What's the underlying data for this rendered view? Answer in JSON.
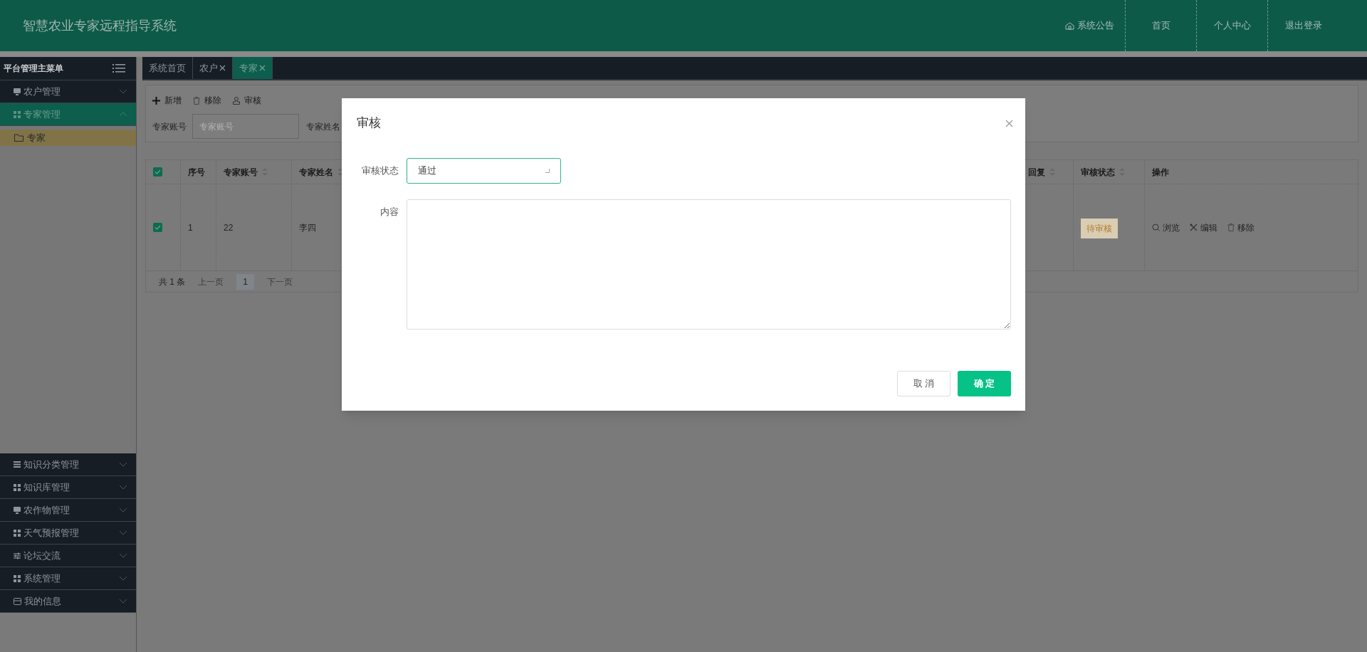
{
  "header": {
    "title": "智慧农业专家远程指导系统",
    "nav": [
      {
        "label": "系统公告",
        "kind": "notice"
      },
      {
        "label": "首页",
        "kind": "link"
      },
      {
        "label": "个人中心",
        "kind": "link"
      },
      {
        "label": "退出登录",
        "kind": "link"
      }
    ]
  },
  "sidebar": {
    "title": "平台管理主菜单",
    "items": [
      {
        "label": "农户管理",
        "kind": "monitor",
        "expanded": false,
        "selected": false
      },
      {
        "label": "专家管理",
        "kind": "grid",
        "expanded": true,
        "selected": true,
        "children": [
          {
            "label": "专家",
            "selected": true
          }
        ]
      },
      {
        "label": "知识分类管理",
        "kind": "list",
        "expanded": false,
        "selected": false
      },
      {
        "label": "知识库管理",
        "kind": "grid",
        "expanded": false,
        "selected": false
      },
      {
        "label": "农作物管理",
        "kind": "monitor",
        "expanded": false,
        "selected": false
      },
      {
        "label": "天气预报管理",
        "kind": "grid",
        "expanded": false,
        "selected": false
      },
      {
        "label": "论坛交流",
        "kind": "sliders",
        "expanded": false,
        "selected": false
      },
      {
        "label": "系统管理",
        "kind": "grid",
        "expanded": false,
        "selected": false
      },
      {
        "label": "我的信息",
        "kind": "card",
        "expanded": false,
        "selected": false
      }
    ]
  },
  "tabs": [
    {
      "label": "系统首页",
      "closable": false,
      "selected": false
    },
    {
      "label": "农户",
      "closable": true,
      "selected": false
    },
    {
      "label": "专家",
      "closable": true,
      "selected": true
    }
  ],
  "toolbar": [
    {
      "label": "新增",
      "kind": "add"
    },
    {
      "label": "移除",
      "kind": "remove"
    },
    {
      "label": "审核",
      "kind": "audit"
    }
  ],
  "filters": [
    {
      "label": "专家账号",
      "placeholder": "专家账号"
    },
    {
      "label": "专家姓名"
    }
  ],
  "table": {
    "all_checked": true,
    "columns": [
      {
        "label": "序号",
        "sortable": false
      },
      {
        "label": "专家账号",
        "sortable": true
      },
      {
        "label": "专家姓名",
        "sortable": true
      },
      {
        "label": "回复",
        "sortable": true
      },
      {
        "label": "审核状态",
        "sortable": true
      },
      {
        "label": "操作",
        "sortable": false
      }
    ],
    "rows": [
      {
        "checked": true,
        "seq": "1",
        "account": "22",
        "name": "李四",
        "status": "待审核",
        "actions": [
          {
            "label": "浏览",
            "kind": "view"
          },
          {
            "label": "编辑",
            "kind": "edit"
          },
          {
            "label": "移除",
            "kind": "remove"
          }
        ]
      }
    ]
  },
  "pagination": {
    "total": "共 1 条",
    "prev": "上一页",
    "page": "1",
    "next": "下一页"
  },
  "modal": {
    "title": "审核",
    "fields": [
      {
        "label": "审核状态",
        "kind": "select",
        "value": "通过"
      },
      {
        "label": "内容",
        "kind": "textarea"
      }
    ],
    "buttons": [
      {
        "label": "取 消",
        "kind": "default"
      },
      {
        "label": "确 定",
        "kind": "primary"
      }
    ]
  }
}
